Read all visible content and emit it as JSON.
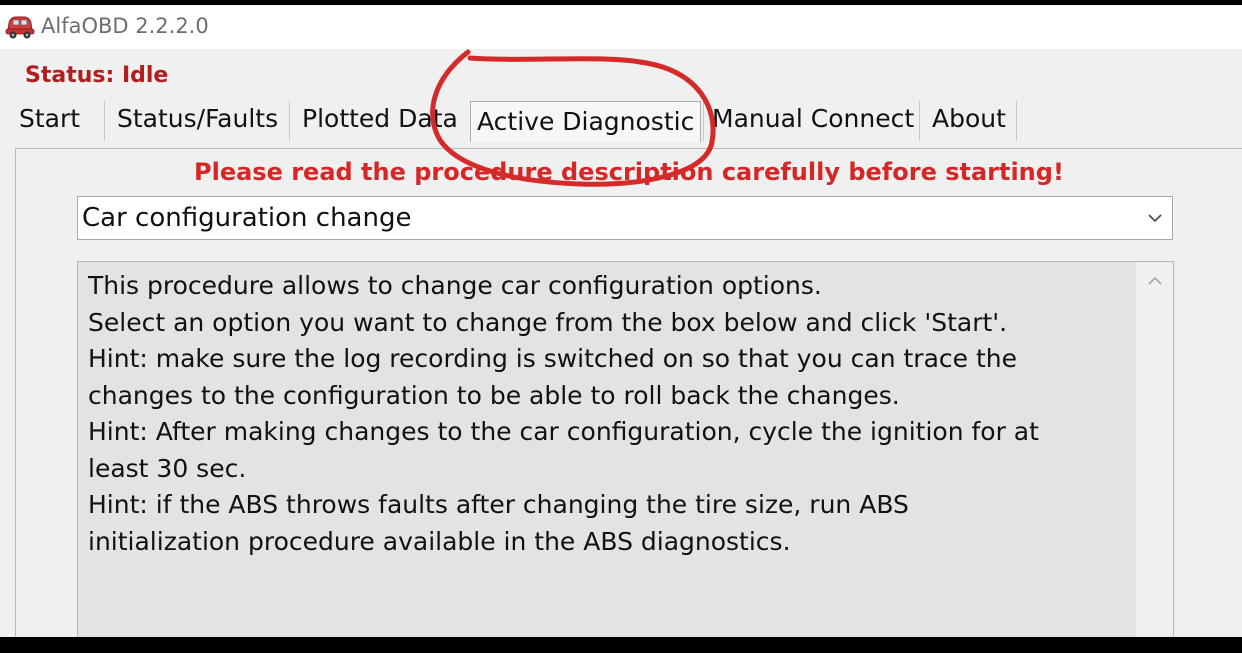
{
  "window": {
    "title": "AlfaOBD 2.2.2.0",
    "icon": "red-car-icon"
  },
  "status": {
    "text": "Status: Idle",
    "color": "#b31d1d"
  },
  "tabs": [
    {
      "label": "Start",
      "active": false
    },
    {
      "label": "Status/Faults",
      "active": false
    },
    {
      "label": "Plotted Data",
      "active": false
    },
    {
      "label": "Active Diagnostic",
      "active": true
    },
    {
      "label": "Manual Connect",
      "active": false
    },
    {
      "label": "About",
      "active": false
    }
  ],
  "active_diagnostic": {
    "warning": "Please read the procedure description carefully before starting!",
    "warning_color": "#d62626",
    "procedure_select": {
      "selected": "Car configuration change",
      "icon": "chevron-down-icon"
    },
    "description_lines": [
      "This procedure allows to change car configuration options.",
      "Select an option you want to change from the box below and click 'Start'.",
      "Hint: make sure the log recording is switched on so that you can trace the",
      "changes to the configuration to be able to roll back the changes.",
      "Hint: After making changes to the car configuration, cycle the ignition for at",
      "least 30 sec.",
      "Hint: if the ABS throws faults after changing the tire size, run ABS",
      "initialization procedure available in the ABS diagnostics."
    ],
    "scroll_icon": "chevron-up-icon"
  },
  "annotation_color": "#d42a2a"
}
